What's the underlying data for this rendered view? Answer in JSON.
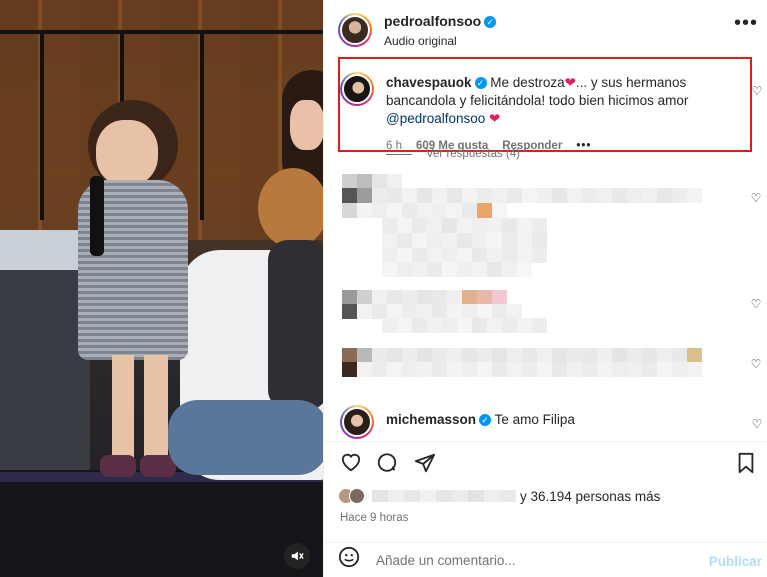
{
  "post": {
    "author": "pedroalfonsoo",
    "audio": "Audio original"
  },
  "comments": [
    {
      "user": "chavespauok",
      "text_part1": " Me destroza",
      "text_part2": "... y sus hermanos bancandola y felicitándola! todo bien hicimos amor ",
      "mention": "@pedroalfonsoo",
      "heart": "❤",
      "age": "6 h",
      "likes": "609 Me gusta",
      "reply_label": "Responder",
      "view_replies": "Ver respuestas (4)"
    },
    {
      "user": "michemasson",
      "text": "Te amo Filipa"
    }
  ],
  "footer": {
    "liked_by_suffix": "y 36.194 personas más",
    "time_ago": "Hace 9 horas",
    "comment_placeholder": "Añade un comentario...",
    "publish_label": "Publicar"
  },
  "icons": {
    "more": "more-options-icon",
    "heart": "heart-icon",
    "comment": "comment-icon",
    "share": "share-icon",
    "save": "save-icon",
    "emoji": "emoji-icon",
    "mute": "mute-icon"
  },
  "colors": {
    "highlight_box": "#e21b1b",
    "verified": "#0095f6",
    "publish_disabled": "#b3dbff",
    "mention": "#00376b"
  }
}
